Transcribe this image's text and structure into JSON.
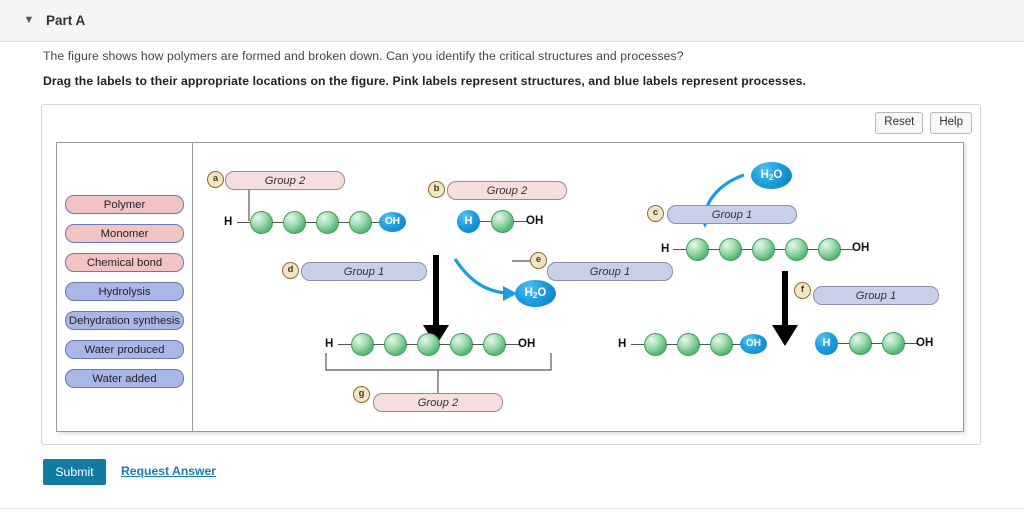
{
  "header": {
    "caret_icon": "caret-down-icon",
    "title": "Part A"
  },
  "question": {
    "prompt": "The figure shows how polymers are formed and broken down. Can you identify the critical structures and processes?",
    "instruction": "Drag the labels to their appropriate locations on the figure. Pink labels represent structures, and blue labels represent processes."
  },
  "toolbar": {
    "reset_label": "Reset",
    "help_label": "Help"
  },
  "label_bank": {
    "items": [
      {
        "text": "Polymer",
        "kind": "pink"
      },
      {
        "text": "Monomer",
        "kind": "pink"
      },
      {
        "text": "Chemical bond",
        "kind": "pink"
      },
      {
        "text": "Hydrolysis",
        "kind": "blue"
      },
      {
        "text": "Dehydration synthesis",
        "kind": "blue"
      },
      {
        "text": "Water produced",
        "kind": "blue"
      },
      {
        "text": "Water added",
        "kind": "blue"
      }
    ]
  },
  "figure": {
    "drop_targets": [
      {
        "id": "a",
        "bullet": "a",
        "text": "Group 2",
        "kind": "pink"
      },
      {
        "id": "b",
        "bullet": "b",
        "text": "Group 2",
        "kind": "pink"
      },
      {
        "id": "c",
        "bullet": "c",
        "text": "Group 1",
        "kind": "blue"
      },
      {
        "id": "d",
        "bullet": "d",
        "text": "Group 1",
        "kind": "blue"
      },
      {
        "id": "e",
        "bullet": "e",
        "text": "Group 1",
        "kind": "blue"
      },
      {
        "id": "f",
        "bullet": "f",
        "text": "Group 1",
        "kind": "blue"
      },
      {
        "id": "g",
        "bullet": "g",
        "text": "Group 2",
        "kind": "pink"
      }
    ],
    "atoms": {
      "h": "H",
      "oh": "OH",
      "water": "H2O",
      "water_main": "H",
      "water_sub": "2",
      "water_tail": "O"
    }
  },
  "actions": {
    "submit_label": "Submit",
    "request_answer_label": "Request Answer"
  },
  "colors": {
    "pink_label": "#f3c2c2",
    "blue_label": "#a9b6e8",
    "sphere_green": "#5cbd79",
    "atom_blue": "#1a9ddd",
    "submit_teal": "#127ba3"
  }
}
